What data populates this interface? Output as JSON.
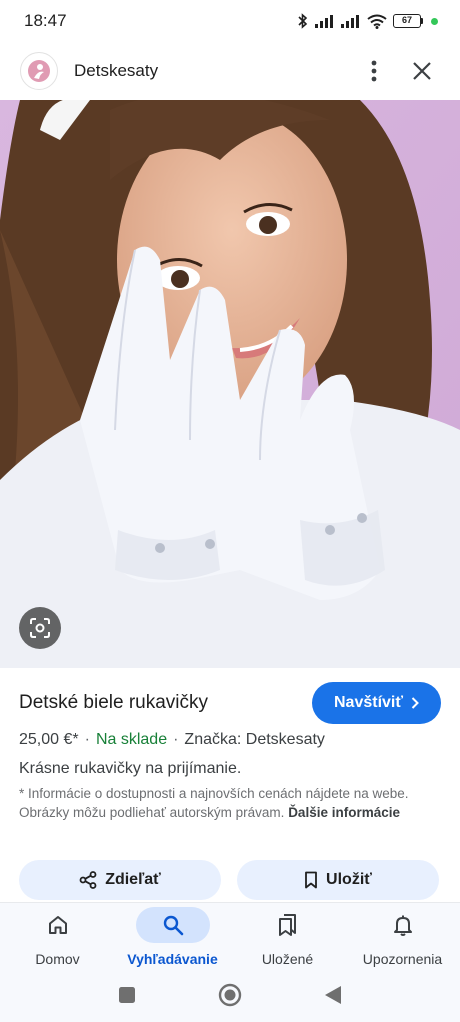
{
  "status_bar": {
    "time": "18:47",
    "battery": "67"
  },
  "header": {
    "site_name": "Detskesaty"
  },
  "product": {
    "title": "Detské biele rukavičky",
    "visit_label": "Navštíviť",
    "price": "25,00 €*",
    "availability": "Na sklade",
    "brand": "Značka: Detskesaty",
    "description": "Krásne rukavičky na prijímanie.",
    "disclaimer": "* Informácie o dostupnosti a najnovších cenách nájdete na webe. Obrázky môžu podliehať autorským právam.",
    "more_link": "Ďalšie informácie"
  },
  "actions": {
    "share_label": "Zdieľať",
    "save_label": "Uložiť"
  },
  "bottom_nav": {
    "items": [
      {
        "label": "Domov",
        "icon": "home-icon"
      },
      {
        "label": "Vyhľadávanie",
        "icon": "search-icon",
        "active": true
      },
      {
        "label": "Uložené",
        "icon": "collections-icon"
      },
      {
        "label": "Upozornenia",
        "icon": "bell-icon"
      }
    ]
  },
  "colors": {
    "accent": "#1a73e8",
    "stock_green": "#188038",
    "pill_bg": "#e8f0fe"
  }
}
